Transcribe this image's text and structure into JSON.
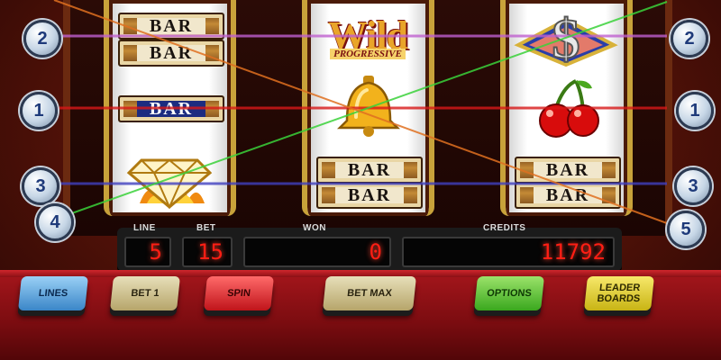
{
  "reels": {
    "reel1": [
      {
        "symbol": "bar",
        "label": "BAR"
      },
      {
        "symbol": "bar",
        "label": "BAR"
      },
      {
        "symbol": "bar-blue",
        "label": "BAR"
      },
      {
        "symbol": "diamond"
      }
    ],
    "reel2": [
      {
        "symbol": "wild",
        "label": "Wild",
        "sublabel": "PROGRESSIVE"
      },
      {
        "symbol": "bell"
      },
      {
        "symbol": "bar",
        "label": "BAR"
      },
      {
        "symbol": "bar",
        "label": "BAR"
      }
    ],
    "reel3": [
      {
        "symbol": "dollar"
      },
      {
        "symbol": "cherry"
      },
      {
        "symbol": "bar",
        "label": "BAR"
      },
      {
        "symbol": "bar",
        "label": "BAR"
      }
    ]
  },
  "paylines": {
    "left_badges": [
      "2",
      "1",
      "3",
      "4"
    ],
    "right_badges": [
      "2",
      "1",
      "3",
      "5"
    ],
    "colors": {
      "line1": "#d81818",
      "line2": "#c060d0",
      "line3": "#4040c0",
      "line4": "#3ad23a",
      "line5": "#e07020"
    }
  },
  "displays": {
    "line_label": "LINE",
    "line_value": "5",
    "bet_label": "BET",
    "bet_value": "15",
    "won_label": "WON",
    "won_value": "0",
    "credits_label": "CREDITS",
    "credits_value": "11792"
  },
  "buttons": {
    "lines": "LINES",
    "bet1": "BET 1",
    "spin": "SPIN",
    "betmax": "BET MAX",
    "options": "OPTIONS",
    "leaderboards": "LEADER BOARDS"
  }
}
